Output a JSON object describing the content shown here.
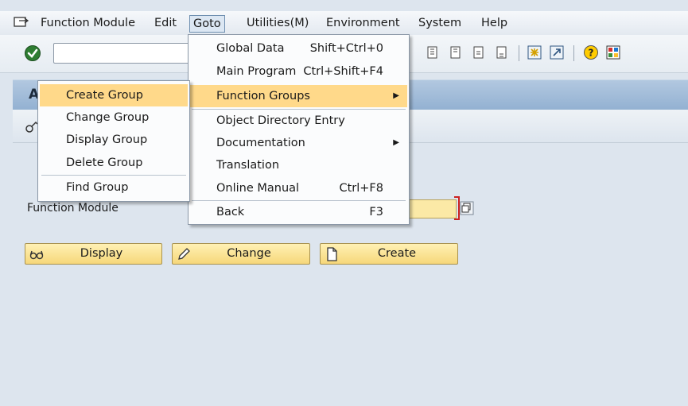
{
  "menubar": {
    "items": [
      {
        "label": "Function Module"
      },
      {
        "label": "Edit"
      },
      {
        "label": "Goto"
      },
      {
        "label": "Utilities(M)"
      },
      {
        "label": "Environment"
      },
      {
        "label": "System"
      },
      {
        "label": "Help"
      }
    ]
  },
  "toolbar": {
    "command_value": ""
  },
  "title": {
    "text": "A"
  },
  "goto_menu": {
    "items": [
      {
        "label": "Global Data",
        "shortcut": "Shift+Ctrl+0"
      },
      {
        "label": "Main Program",
        "shortcut": "Ctrl+Shift+F4"
      },
      {
        "label": "Function Groups",
        "shortcut": "",
        "submenu": true
      },
      {
        "label": "Object Directory Entry",
        "shortcut": ""
      },
      {
        "label": "Documentation",
        "shortcut": "",
        "submenu": true
      },
      {
        "label": "Translation",
        "shortcut": ""
      },
      {
        "label": "Online Manual",
        "shortcut": "Ctrl+F8"
      },
      {
        "label": "Back",
        "shortcut": "F3"
      }
    ]
  },
  "function_groups_menu": {
    "items": [
      {
        "label": "Create Group"
      },
      {
        "label": "Change Group"
      },
      {
        "label": "Display Group"
      },
      {
        "label": "Delete Group"
      },
      {
        "label": "Find Group"
      }
    ]
  },
  "form": {
    "function_module_label": "Function Module",
    "function_module_value": ""
  },
  "buttons": {
    "display": "Display",
    "change": "Change",
    "create": "Create"
  },
  "colors": {
    "menu_highlight": "#ffd98a",
    "button_fill": "#f6d77a",
    "title_bar": "#93b1d2",
    "required_marker": "#cc2222"
  }
}
